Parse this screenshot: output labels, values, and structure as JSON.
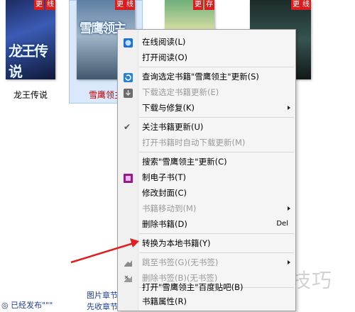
{
  "shelf": {
    "books": [
      {
        "title": "龙王传说",
        "badges": [
          "更",
          "线"
        ],
        "cover_text": "龙王传说"
      },
      {
        "title": "雪鹰领主",
        "badges": [
          "更",
          "线"
        ],
        "cover_text": "雪鹰领主"
      },
      {
        "title": "",
        "badges": [
          "更",
          "存"
        ]
      },
      {
        "title": "",
        "badges": [
          "更",
          "线"
        ]
      }
    ],
    "bottom_left": "◎ 已经发布\"\"\"",
    "bottom_center_1": "图片章节",
    "bottom_center_2": "先收章节"
  },
  "context_menu": {
    "items": [
      {
        "label": "在线阅读(L)",
        "icon": "globe-icon"
      },
      {
        "label": "打开阅读(O)"
      },
      {
        "label": "查询选定书籍\"雪鹰领主\"更新(S)",
        "icon": "refresh-icon"
      },
      {
        "label": "下载选定书籍更新(E)",
        "icon": "download-icon"
      },
      {
        "label": "下载与修复(K)"
      },
      {
        "label": "关注书籍更新(U)"
      },
      {
        "label": "打开书籍时自动下载更新(M)"
      },
      {
        "label": "搜索\"雪鹰领主\"更新(C)"
      },
      {
        "label": "制电子书(T)",
        "icon": "ebook-icon"
      },
      {
        "label": "修改封面(C)"
      },
      {
        "label": "书籍移动到(M)"
      },
      {
        "label": "删除书籍(D)",
        "shortcut": "Del"
      },
      {
        "label": "转换为本地书籍(Y)"
      },
      {
        "label": "跳至书签(G)(无书签)",
        "icon": "bookmark-jump-icon"
      },
      {
        "label": "删除书签(B)(无书签)",
        "icon": "bookmark-delete-icon"
      },
      {
        "label": "打开\"雪鹰领主\"百度贴吧(B)"
      },
      {
        "label": "书籍属性(R)"
      }
    ]
  },
  "watermark": "软件技巧",
  "colors": {
    "badge": "#d81e1e",
    "selection": "#d9e8fb",
    "arrow": "#e02020"
  }
}
